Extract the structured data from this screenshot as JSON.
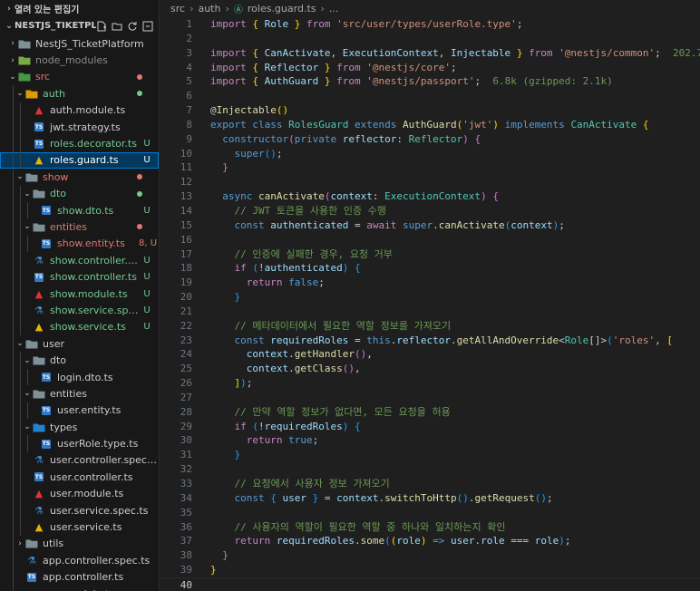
{
  "explorer": {
    "open_editors_label": "열려 있는 편집기",
    "project_title": "NESTJS_TIKETPL..."
  },
  "tree": [
    {
      "depth": 0,
      "chev": "›",
      "icon": "folder",
      "label": "NestJS_TicketPlatform",
      "color": "#cccccc",
      "badge": "",
      "dot": ""
    },
    {
      "depth": 0,
      "chev": "›",
      "icon": "folder-node",
      "label": "node_modules",
      "color": "#8c8c8c",
      "badge": "",
      "dot": ""
    },
    {
      "depth": 0,
      "chev": "⌄",
      "icon": "folder-src",
      "label": "src",
      "color": "#e2786d",
      "badge": "",
      "dot": "#e2786d"
    },
    {
      "depth": 1,
      "chev": "⌄",
      "icon": "folder-auth",
      "label": "auth",
      "color": "#73c991",
      "badge": "",
      "dot": "#73c991"
    },
    {
      "depth": 2,
      "chev": "",
      "icon": "ng",
      "label": "auth.module.ts",
      "color": "#cccccc",
      "badge": "",
      "dot": ""
    },
    {
      "depth": 2,
      "chev": "",
      "icon": "ts",
      "label": "jwt.strategy.ts",
      "color": "#cccccc",
      "badge": "",
      "dot": ""
    },
    {
      "depth": 2,
      "chev": "",
      "icon": "ts",
      "label": "roles.decorator.ts",
      "color": "#73c991",
      "badge": "U",
      "dot": ""
    },
    {
      "depth": 2,
      "chev": "",
      "icon": "svc",
      "label": "roles.guard.ts",
      "color": "#73c991",
      "badge": "U",
      "dot": "",
      "selected": true
    },
    {
      "depth": 1,
      "chev": "⌄",
      "icon": "folder",
      "label": "show",
      "color": "#e2786d",
      "badge": "",
      "dot": "#e2786d"
    },
    {
      "depth": 2,
      "chev": "⌄",
      "icon": "folder",
      "label": "dto",
      "color": "#73c991",
      "badge": "",
      "dot": "#73c991"
    },
    {
      "depth": 3,
      "chev": "",
      "icon": "ts",
      "label": "show.dto.ts",
      "color": "#73c991",
      "badge": "U",
      "dot": ""
    },
    {
      "depth": 2,
      "chev": "⌄",
      "icon": "folder",
      "label": "entities",
      "color": "#e2786d",
      "badge": "",
      "dot": "#e2786d"
    },
    {
      "depth": 3,
      "chev": "",
      "icon": "ts",
      "label": "show.entity.ts",
      "color": "#e2786d",
      "badge": "8, U",
      "dot": ""
    },
    {
      "depth": 2,
      "chev": "",
      "icon": "test",
      "label": "show.controller.s...",
      "color": "#73c991",
      "badge": "U",
      "dot": ""
    },
    {
      "depth": 2,
      "chev": "",
      "icon": "ts",
      "label": "show.controller.ts",
      "color": "#73c991",
      "badge": "U",
      "dot": ""
    },
    {
      "depth": 2,
      "chev": "",
      "icon": "ng",
      "label": "show.module.ts",
      "color": "#73c991",
      "badge": "U",
      "dot": ""
    },
    {
      "depth": 2,
      "chev": "",
      "icon": "test",
      "label": "show.service.spe...",
      "color": "#73c991",
      "badge": "U",
      "dot": ""
    },
    {
      "depth": 2,
      "chev": "",
      "icon": "svc",
      "label": "show.service.ts",
      "color": "#73c991",
      "badge": "U",
      "dot": ""
    },
    {
      "depth": 1,
      "chev": "⌄",
      "icon": "folder",
      "label": "user",
      "color": "#cccccc",
      "badge": "",
      "dot": ""
    },
    {
      "depth": 2,
      "chev": "⌄",
      "icon": "folder",
      "label": "dto",
      "color": "#cccccc",
      "badge": "",
      "dot": ""
    },
    {
      "depth": 3,
      "chev": "",
      "icon": "ts",
      "label": "login.dto.ts",
      "color": "#cccccc",
      "badge": "",
      "dot": ""
    },
    {
      "depth": 2,
      "chev": "⌄",
      "icon": "folder",
      "label": "entities",
      "color": "#cccccc",
      "badge": "",
      "dot": ""
    },
    {
      "depth": 3,
      "chev": "",
      "icon": "ts",
      "label": "user.entity.ts",
      "color": "#cccccc",
      "badge": "",
      "dot": ""
    },
    {
      "depth": 2,
      "chev": "⌄",
      "icon": "folder-types",
      "label": "types",
      "color": "#cccccc",
      "badge": "",
      "dot": ""
    },
    {
      "depth": 3,
      "chev": "",
      "icon": "ts",
      "label": "userRole.type.ts",
      "color": "#cccccc",
      "badge": "",
      "dot": ""
    },
    {
      "depth": 2,
      "chev": "",
      "icon": "test",
      "label": "user.controller.spec.ts",
      "color": "#cccccc",
      "badge": "",
      "dot": ""
    },
    {
      "depth": 2,
      "chev": "",
      "icon": "ts",
      "label": "user.controller.ts",
      "color": "#cccccc",
      "badge": "",
      "dot": ""
    },
    {
      "depth": 2,
      "chev": "",
      "icon": "ng",
      "label": "user.module.ts",
      "color": "#cccccc",
      "badge": "",
      "dot": ""
    },
    {
      "depth": 2,
      "chev": "",
      "icon": "test",
      "label": "user.service.spec.ts",
      "color": "#cccccc",
      "badge": "",
      "dot": ""
    },
    {
      "depth": 2,
      "chev": "",
      "icon": "svc",
      "label": "user.service.ts",
      "color": "#cccccc",
      "badge": "",
      "dot": ""
    },
    {
      "depth": 1,
      "chev": "›",
      "icon": "folder",
      "label": "utils",
      "color": "#cccccc",
      "badge": "",
      "dot": ""
    },
    {
      "depth": 1,
      "chev": "",
      "icon": "test",
      "label": "app.controller.spec.ts",
      "color": "#cccccc",
      "badge": "",
      "dot": ""
    },
    {
      "depth": 1,
      "chev": "",
      "icon": "ts",
      "label": "app.controller.ts",
      "color": "#cccccc",
      "badge": "",
      "dot": ""
    },
    {
      "depth": 1,
      "chev": "",
      "icon": "ng",
      "label": "app.module.ts",
      "color": "#cccccc",
      "badge": "",
      "dot": ""
    }
  ],
  "breadcrumb": {
    "seg1": "src",
    "seg2": "auth",
    "seg3": "roles.guard.ts",
    "seg4": "..."
  },
  "code": [
    [
      [
        "kw",
        "import"
      ],
      [
        "p",
        " "
      ],
      [
        "br1",
        "{"
      ],
      [
        "p",
        " "
      ],
      [
        "var",
        "Role"
      ],
      [
        "p",
        " "
      ],
      [
        "br1",
        "}"
      ],
      [
        "p",
        " "
      ],
      [
        "kw",
        "from"
      ],
      [
        "p",
        " "
      ],
      [
        "str",
        "'src/user/types/userRole.type'"
      ],
      [
        "p",
        ";"
      ]
    ],
    [],
    [
      [
        "kw",
        "import"
      ],
      [
        "p",
        " "
      ],
      [
        "br1",
        "{"
      ],
      [
        "p",
        " "
      ],
      [
        "var",
        "CanActivate"
      ],
      [
        "p",
        ", "
      ],
      [
        "var",
        "ExecutionContext"
      ],
      [
        "p",
        ", "
      ],
      [
        "var",
        "Injectable"
      ],
      [
        "p",
        " "
      ],
      [
        "br1",
        "}"
      ],
      [
        "p",
        " "
      ],
      [
        "kw",
        "from"
      ],
      [
        "p",
        " "
      ],
      [
        "str",
        "'@nestjs/common'"
      ],
      [
        "p",
        ";  "
      ],
      [
        "sz",
        "202.7k"
      ]
    ],
    [
      [
        "kw",
        "import"
      ],
      [
        "p",
        " "
      ],
      [
        "br1",
        "{"
      ],
      [
        "p",
        " "
      ],
      [
        "var",
        "Reflector"
      ],
      [
        "p",
        " "
      ],
      [
        "br1",
        "}"
      ],
      [
        "p",
        " "
      ],
      [
        "kw",
        "from"
      ],
      [
        "p",
        " "
      ],
      [
        "str",
        "'@nestjs/core'"
      ],
      [
        "p",
        ";"
      ]
    ],
    [
      [
        "kw",
        "import"
      ],
      [
        "p",
        " "
      ],
      [
        "br1",
        "{"
      ],
      [
        "p",
        " "
      ],
      [
        "var",
        "AuthGuard"
      ],
      [
        "p",
        " "
      ],
      [
        "br1",
        "}"
      ],
      [
        "p",
        " "
      ],
      [
        "kw",
        "from"
      ],
      [
        "p",
        " "
      ],
      [
        "str",
        "'@nestjs/passport'"
      ],
      [
        "p",
        ";  "
      ],
      [
        "sz",
        "6.8k (gzipped: 2.1k)"
      ]
    ],
    [],
    [
      [
        "p",
        "@"
      ],
      [
        "fn",
        "Injectable"
      ],
      [
        "br1",
        "()"
      ]
    ],
    [
      [
        "kb",
        "export"
      ],
      [
        "p",
        " "
      ],
      [
        "kb",
        "class"
      ],
      [
        "p",
        " "
      ],
      [
        "ty",
        "RolesGuard"
      ],
      [
        "p",
        " "
      ],
      [
        "kb",
        "extends"
      ],
      [
        "p",
        " "
      ],
      [
        "fn",
        "AuthGuard"
      ],
      [
        "br1",
        "("
      ],
      [
        "str",
        "'jwt'"
      ],
      [
        "br1",
        ")"
      ],
      [
        "p",
        " "
      ],
      [
        "kb",
        "implements"
      ],
      [
        "p",
        " "
      ],
      [
        "ty",
        "CanActivate"
      ],
      [
        "p",
        " "
      ],
      [
        "br1",
        "{"
      ]
    ],
    [
      [
        "p",
        "  "
      ],
      [
        "kb",
        "constructor"
      ],
      [
        "br2",
        "("
      ],
      [
        "kb",
        "private"
      ],
      [
        "p",
        " "
      ],
      [
        "var",
        "reflector"
      ],
      [
        "p",
        ": "
      ],
      [
        "ty",
        "Reflector"
      ],
      [
        "br2",
        ")"
      ],
      [
        "p",
        " "
      ],
      [
        "br2",
        "{"
      ]
    ],
    [
      [
        "p",
        "    "
      ],
      [
        "kb",
        "super"
      ],
      [
        "br3",
        "()"
      ],
      [
        "p",
        ";"
      ]
    ],
    [
      [
        "p",
        "  "
      ],
      [
        "br2",
        "}"
      ]
    ],
    [],
    [
      [
        "p",
        "  "
      ],
      [
        "kb",
        "async"
      ],
      [
        "p",
        " "
      ],
      [
        "fn",
        "canActivate"
      ],
      [
        "br2",
        "("
      ],
      [
        "var",
        "context"
      ],
      [
        "p",
        ": "
      ],
      [
        "ty",
        "ExecutionContext"
      ],
      [
        "br2",
        ")"
      ],
      [
        "p",
        " "
      ],
      [
        "br2",
        "{"
      ]
    ],
    [
      [
        "p",
        "    "
      ],
      [
        "cm",
        "// JWT 토큰을 사용한 인증 수행"
      ]
    ],
    [
      [
        "p",
        "    "
      ],
      [
        "kb",
        "const"
      ],
      [
        "p",
        " "
      ],
      [
        "var",
        "authenticated"
      ],
      [
        "p",
        " = "
      ],
      [
        "kw",
        "await"
      ],
      [
        "p",
        " "
      ],
      [
        "kb",
        "super"
      ],
      [
        "p",
        "."
      ],
      [
        "fn",
        "canActivate"
      ],
      [
        "br3",
        "("
      ],
      [
        "var",
        "context"
      ],
      [
        "br3",
        ")"
      ],
      [
        "p",
        ";"
      ]
    ],
    [],
    [
      [
        "p",
        "    "
      ],
      [
        "cm",
        "// 인증에 실패한 경우, 요청 거부"
      ]
    ],
    [
      [
        "p",
        "    "
      ],
      [
        "kw",
        "if"
      ],
      [
        "p",
        " "
      ],
      [
        "br3",
        "("
      ],
      [
        "p",
        "!"
      ],
      [
        "var",
        "authenticated"
      ],
      [
        "br3",
        ")"
      ],
      [
        "p",
        " "
      ],
      [
        "br3",
        "{"
      ]
    ],
    [
      [
        "p",
        "      "
      ],
      [
        "kw",
        "return"
      ],
      [
        "p",
        " "
      ],
      [
        "kb",
        "false"
      ],
      [
        "p",
        ";"
      ]
    ],
    [
      [
        "p",
        "    "
      ],
      [
        "br3",
        "}"
      ]
    ],
    [],
    [
      [
        "p",
        "    "
      ],
      [
        "cm",
        "// 메타데이터에서 필요한 역할 정보를 가져오기"
      ]
    ],
    [
      [
        "p",
        "    "
      ],
      [
        "kb",
        "const"
      ],
      [
        "p",
        " "
      ],
      [
        "var",
        "requiredRoles"
      ],
      [
        "p",
        " = "
      ],
      [
        "kb",
        "this"
      ],
      [
        "p",
        "."
      ],
      [
        "var",
        "reflector"
      ],
      [
        "p",
        "."
      ],
      [
        "fn",
        "getAllAndOverride"
      ],
      [
        "p",
        "<"
      ],
      [
        "ty",
        "Role"
      ],
      [
        "p",
        "[]>"
      ],
      [
        "br3",
        "("
      ],
      [
        "str",
        "'roles'"
      ],
      [
        "p",
        ", "
      ],
      [
        "br1",
        "["
      ]
    ],
    [
      [
        "p",
        "      "
      ],
      [
        "var",
        "context"
      ],
      [
        "p",
        "."
      ],
      [
        "fn",
        "getHandler"
      ],
      [
        "br2",
        "()"
      ],
      [
        "p",
        ","
      ]
    ],
    [
      [
        "p",
        "      "
      ],
      [
        "var",
        "context"
      ],
      [
        "p",
        "."
      ],
      [
        "fn",
        "getClass"
      ],
      [
        "br2",
        "()"
      ],
      [
        "p",
        ","
      ]
    ],
    [
      [
        "p",
        "    "
      ],
      [
        "br1",
        "]"
      ],
      [
        "br3",
        ")"
      ],
      [
        "p",
        ";"
      ]
    ],
    [],
    [
      [
        "p",
        "    "
      ],
      [
        "cm",
        "// 만약 역할 정보가 없다면, 모든 요청을 허용"
      ]
    ],
    [
      [
        "p",
        "    "
      ],
      [
        "kw",
        "if"
      ],
      [
        "p",
        " "
      ],
      [
        "br3",
        "("
      ],
      [
        "p",
        "!"
      ],
      [
        "var",
        "requiredRoles"
      ],
      [
        "br3",
        ")"
      ],
      [
        "p",
        " "
      ],
      [
        "br3",
        "{"
      ]
    ],
    [
      [
        "p",
        "      "
      ],
      [
        "kw",
        "return"
      ],
      [
        "p",
        " "
      ],
      [
        "kb",
        "true"
      ],
      [
        "p",
        ";"
      ]
    ],
    [
      [
        "p",
        "    "
      ],
      [
        "br3",
        "}"
      ]
    ],
    [],
    [
      [
        "p",
        "    "
      ],
      [
        "cm",
        "// 요청에서 사용자 정보 가져오기"
      ]
    ],
    [
      [
        "p",
        "    "
      ],
      [
        "kb",
        "const"
      ],
      [
        "p",
        " "
      ],
      [
        "br3",
        "{"
      ],
      [
        "p",
        " "
      ],
      [
        "var",
        "user"
      ],
      [
        "p",
        " "
      ],
      [
        "br3",
        "}"
      ],
      [
        "p",
        " = "
      ],
      [
        "var",
        "context"
      ],
      [
        "p",
        "."
      ],
      [
        "fn",
        "switchToHttp"
      ],
      [
        "br3",
        "()"
      ],
      [
        "p",
        "."
      ],
      [
        "fn",
        "getRequest"
      ],
      [
        "br3",
        "()"
      ],
      [
        "p",
        ";"
      ]
    ],
    [],
    [
      [
        "p",
        "    "
      ],
      [
        "cm",
        "// 사용자의 역할이 필요한 역할 중 하나와 일치하는지 확인"
      ]
    ],
    [
      [
        "p",
        "    "
      ],
      [
        "kw",
        "return"
      ],
      [
        "p",
        " "
      ],
      [
        "var",
        "requiredRoles"
      ],
      [
        "p",
        "."
      ],
      [
        "fn",
        "some"
      ],
      [
        "br3",
        "("
      ],
      [
        "br1",
        "("
      ],
      [
        "var",
        "role"
      ],
      [
        "br1",
        ")"
      ],
      [
        "p",
        " "
      ],
      [
        "kb",
        "=>"
      ],
      [
        "p",
        " "
      ],
      [
        "var",
        "user"
      ],
      [
        "p",
        "."
      ],
      [
        "var",
        "role"
      ],
      [
        "p",
        " === "
      ],
      [
        "var",
        "role"
      ],
      [
        "br3",
        ")"
      ],
      [
        "p",
        ";"
      ]
    ],
    [
      [
        "p",
        "  "
      ],
      [
        "br2",
        "}"
      ]
    ],
    [
      [
        "br1",
        "}"
      ]
    ],
    []
  ],
  "current_line": 40
}
